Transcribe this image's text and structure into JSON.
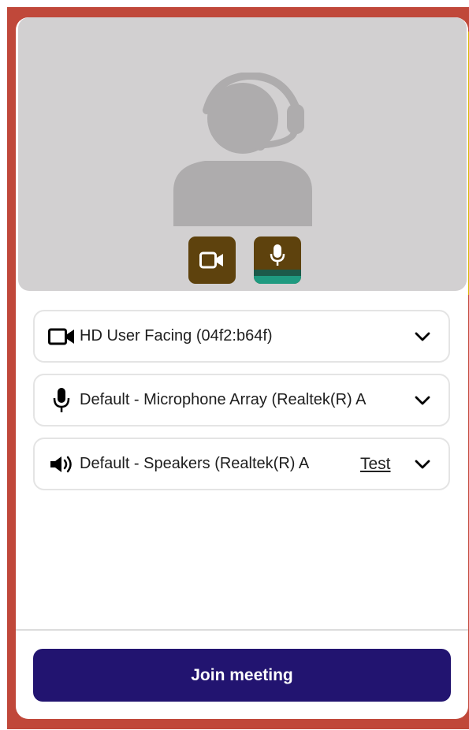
{
  "preview": {
    "avatar_icon": "headset-user-icon",
    "camera_toggle_icon": "video-camera-icon",
    "mic_toggle_icon": "microphone-icon",
    "mic_level": 0.3
  },
  "devices": {
    "camera": {
      "icon": "video-camera-icon",
      "label": "HD User Facing (04f2:b64f)"
    },
    "microphone": {
      "icon": "microphone-icon",
      "label": "Default - Microphone Array (Realtek(R) A"
    },
    "speaker": {
      "icon": "speaker-icon",
      "label": "Default - Speakers (Realtek(R) A",
      "test_label": "Test"
    }
  },
  "join_button": {
    "label": "Join meeting"
  },
  "colors": {
    "frame": "#c0483a",
    "accent_yellow": "#d6b800",
    "toggle_bg": "#5e420d",
    "mic_level": "#1f9a80",
    "join_bg": "#221470"
  }
}
